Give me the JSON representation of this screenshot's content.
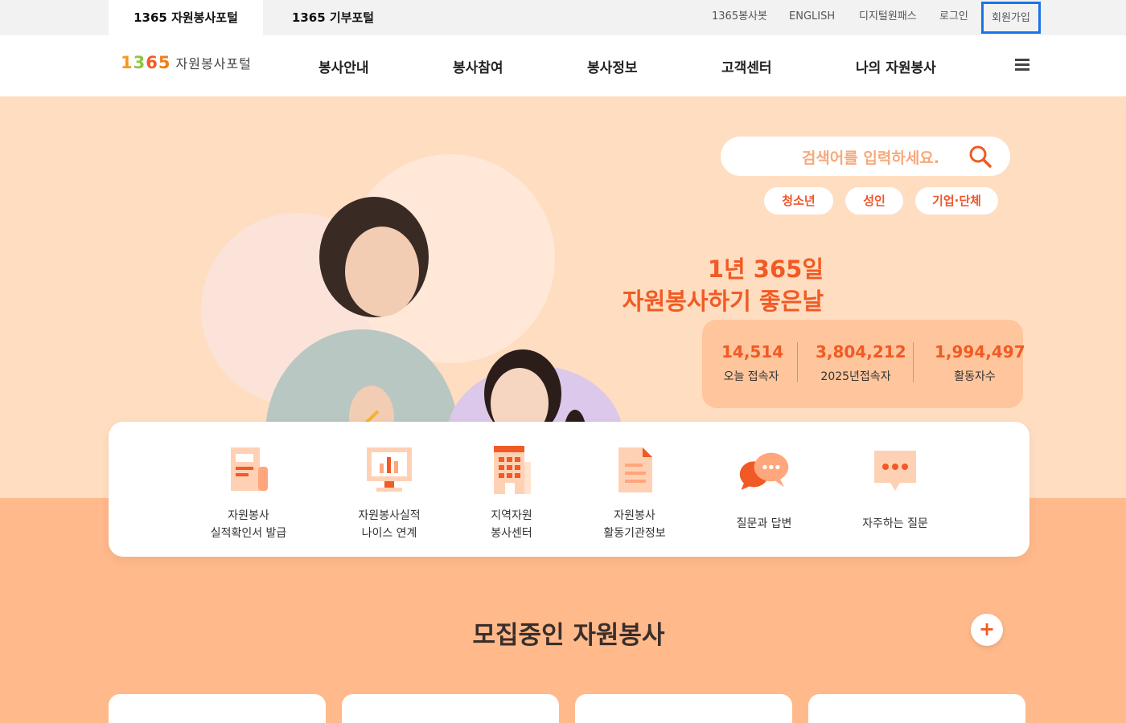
{
  "topbar": {
    "tabs": [
      "1365 자원봉사포털",
      "1365 기부포털"
    ],
    "links": [
      "1365봉사봇",
      "ENGLISH",
      "디지털원패스",
      "로그인",
      "회원가입"
    ]
  },
  "nav": {
    "logo_num": [
      "1",
      "3",
      "6",
      "5"
    ],
    "logo_text": "자원봉사포털",
    "menu": [
      "봉사안내",
      "봉사참여",
      "봉사정보",
      "고객센터",
      "나의 자원봉사"
    ]
  },
  "hero": {
    "search_placeholder": "검색어를 입력하세요.",
    "tags": [
      "청소년",
      "성인",
      "기업·단체"
    ],
    "slogan_line1": "1년 365일",
    "slogan_line2": "자원봉사하기 좋은날",
    "stats": [
      {
        "value": "14,514",
        "label": "오늘 접속자"
      },
      {
        "value": "3,804,212",
        "label": "2025년접속자"
      },
      {
        "value": "1,994,497",
        "label": "활동자수"
      }
    ]
  },
  "quick_menu": [
    {
      "line1": "자원봉사",
      "line2": "실적확인서 발급",
      "icon": "certificate-icon"
    },
    {
      "line1": "자원봉사실적",
      "line2": "나이스 연계",
      "icon": "monitor-chart-icon"
    },
    {
      "line1": "지역자원",
      "line2": "봉사센터",
      "icon": "building-icon"
    },
    {
      "line1": "자원봉사",
      "line2": "활동기관정보",
      "icon": "document-icon"
    },
    {
      "line1": "질문과 답변",
      "line2": "",
      "icon": "chat-bubbles-icon"
    },
    {
      "line1": "자주하는 질문",
      "line2": "",
      "icon": "faq-bubble-icon"
    }
  ],
  "recruiting": {
    "title": "모집중인 자원봉사",
    "more_label": "+"
  },
  "colors": {
    "accent": "#f15a24",
    "hero_bg": "#ffddc0",
    "lower_bg": "#ffb98b",
    "highlight_border": "#1a73e8"
  }
}
